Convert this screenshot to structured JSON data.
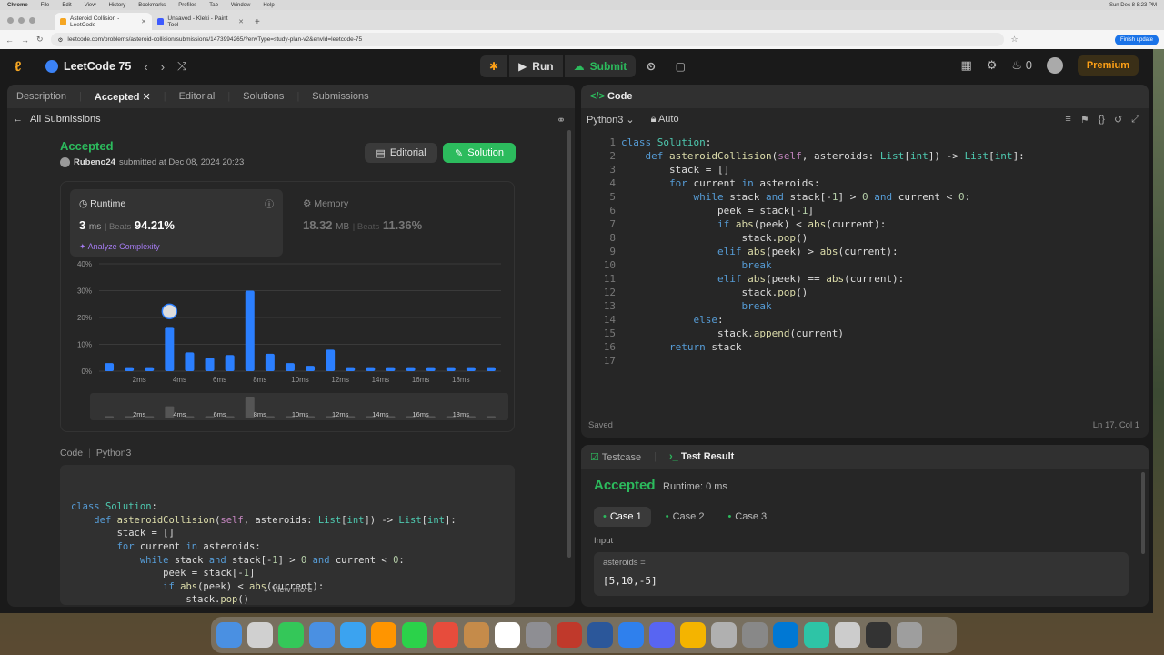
{
  "macbar": {
    "items": [
      "Chrome",
      "File",
      "Edit",
      "View",
      "History",
      "Bookmarks",
      "Profiles",
      "Tab",
      "Window",
      "Help"
    ],
    "clock": "Sun Dec 8  8:23 PM"
  },
  "chrome": {
    "tabs": [
      {
        "title": "Asteroid Collision - LeetCode",
        "fav": "#f5a623"
      },
      {
        "title": "Unsaved - Kleki - Paint Tool",
        "fav": "#3d5afe"
      }
    ],
    "url": "leetcode.com/problems/asteroid-collision/submissions/1473994265/?envType=study-plan-v2&envId=leetcode-75",
    "update": "Finish update"
  },
  "topbar": {
    "list": "LeetCode 75",
    "run": "Run",
    "submit": "Submit",
    "streak": "0",
    "premium": "Premium"
  },
  "left": {
    "tabs": [
      "Description",
      "Accepted",
      "Editorial",
      "Solutions",
      "Submissions"
    ],
    "all_submissions": "All Submissions",
    "status": "Accepted",
    "user": "Rubeno24",
    "submitted": "submitted at Dec 08, 2024 20:23",
    "editorial_btn": "Editorial",
    "solution_btn": "Solution",
    "runtime": {
      "title": "Runtime",
      "value": "3",
      "unit": "ms",
      "beats_label": "Beats",
      "beats": "94.21%",
      "analyze": "Analyze Complexity"
    },
    "memory": {
      "title": "Memory",
      "value": "18.32",
      "unit": "MB",
      "beats_label": "Beats",
      "beats": "11.36%"
    },
    "code_label": "Code",
    "code_lang": "Python3",
    "view_more": "View more"
  },
  "chart_data": {
    "type": "bar",
    "yticks": [
      "40%",
      "30%",
      "20%",
      "10%",
      "0%"
    ],
    "ylim": [
      0,
      40
    ],
    "xticks": [
      "2ms",
      "4ms",
      "6ms",
      "8ms",
      "10ms",
      "12ms",
      "14ms",
      "16ms",
      "18ms"
    ],
    "values": [
      3,
      1.5,
      1.5,
      16.5,
      7,
      5,
      6,
      30,
      6.5,
      3,
      2,
      8,
      1.5,
      1.5,
      1.5,
      1.5,
      1.5,
      1.5,
      1.5,
      1.5
    ],
    "bar_color": "#2b7fff",
    "highlight_index": 3,
    "mini_values": [
      1,
      1,
      1,
      5,
      1,
      1,
      1,
      9,
      1,
      1,
      1,
      1,
      1,
      1,
      1,
      1,
      1,
      1,
      1,
      1
    ],
    "grid": true,
    "legend": "none"
  },
  "right": {
    "code_title": "Code",
    "lang": "Python3",
    "auto": "Auto",
    "saved": "Saved",
    "cursor": "Ln 17, Col 1",
    "testcase_tab": "Testcase",
    "result_tab": "Test Result",
    "result": "Accepted",
    "runtime": "Runtime: 0 ms",
    "cases": [
      "Case 1",
      "Case 2",
      "Case 3"
    ],
    "input_label": "Input",
    "input_name": "asteroids =",
    "input_value": "[5,10,-5]"
  },
  "code_lines": [
    "class Solution:",
    "    def asteroidCollision(self, asteroids: List[int]) -> List[int]:",
    "        stack = []",
    "        for current in asteroids:",
    "            while stack and stack[-1] > 0 and current < 0:",
    "                peek = stack[-1]",
    "                if abs(peek) < abs(current):",
    "                    stack.pop()",
    "                elif abs(peek) > abs(current):",
    "                    break",
    "                elif abs(peek) == abs(current):",
    "                    stack.pop()",
    "                    break",
    "            else:",
    "                stack.append(current)",
    "        return stack",
    ""
  ],
  "dock_colors": [
    "#4a90e2",
    "#d0d0d0",
    "#34c759",
    "#4a90e2",
    "#3ba3f0",
    "#ff9500",
    "#2bd24a",
    "#e74c3c",
    "#c58b4a",
    "#ffffff",
    "#8e8e93",
    "#c0392b",
    "#2b579a",
    "#2f80ed",
    "#5865f2",
    "#f4b400",
    "#b0b0b0",
    "#888888",
    "#0078d4",
    "#2ec4a6",
    "#cccccc",
    "#333333",
    "#9e9e9e"
  ]
}
